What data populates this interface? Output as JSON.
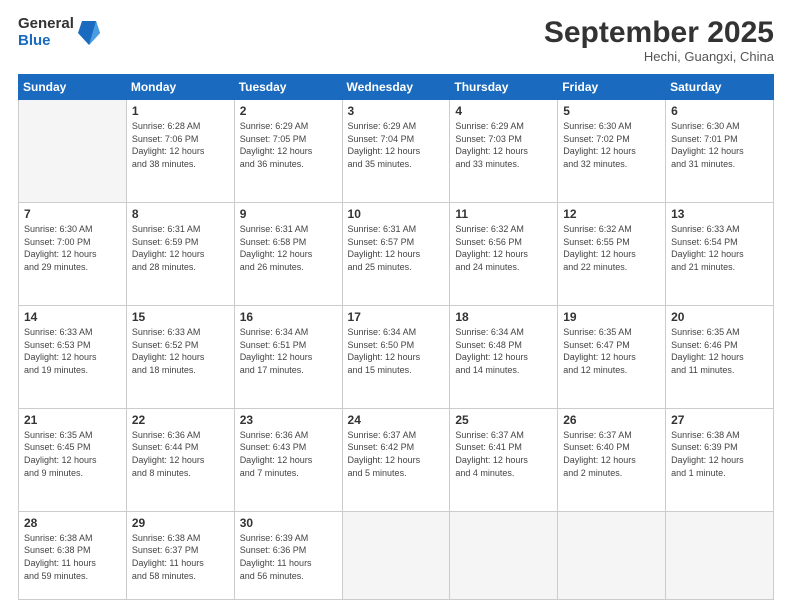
{
  "logo": {
    "general": "General",
    "blue": "Blue"
  },
  "title": {
    "month": "September 2025",
    "location": "Hechi, Guangxi, China"
  },
  "headers": [
    "Sunday",
    "Monday",
    "Tuesday",
    "Wednesday",
    "Thursday",
    "Friday",
    "Saturday"
  ],
  "weeks": [
    [
      {
        "day": "",
        "text": ""
      },
      {
        "day": "1",
        "text": "Sunrise: 6:28 AM\nSunset: 7:06 PM\nDaylight: 12 hours\nand 38 minutes."
      },
      {
        "day": "2",
        "text": "Sunrise: 6:29 AM\nSunset: 7:05 PM\nDaylight: 12 hours\nand 36 minutes."
      },
      {
        "day": "3",
        "text": "Sunrise: 6:29 AM\nSunset: 7:04 PM\nDaylight: 12 hours\nand 35 minutes."
      },
      {
        "day": "4",
        "text": "Sunrise: 6:29 AM\nSunset: 7:03 PM\nDaylight: 12 hours\nand 33 minutes."
      },
      {
        "day": "5",
        "text": "Sunrise: 6:30 AM\nSunset: 7:02 PM\nDaylight: 12 hours\nand 32 minutes."
      },
      {
        "day": "6",
        "text": "Sunrise: 6:30 AM\nSunset: 7:01 PM\nDaylight: 12 hours\nand 31 minutes."
      }
    ],
    [
      {
        "day": "7",
        "text": "Sunrise: 6:30 AM\nSunset: 7:00 PM\nDaylight: 12 hours\nand 29 minutes."
      },
      {
        "day": "8",
        "text": "Sunrise: 6:31 AM\nSunset: 6:59 PM\nDaylight: 12 hours\nand 28 minutes."
      },
      {
        "day": "9",
        "text": "Sunrise: 6:31 AM\nSunset: 6:58 PM\nDaylight: 12 hours\nand 26 minutes."
      },
      {
        "day": "10",
        "text": "Sunrise: 6:31 AM\nSunset: 6:57 PM\nDaylight: 12 hours\nand 25 minutes."
      },
      {
        "day": "11",
        "text": "Sunrise: 6:32 AM\nSunset: 6:56 PM\nDaylight: 12 hours\nand 24 minutes."
      },
      {
        "day": "12",
        "text": "Sunrise: 6:32 AM\nSunset: 6:55 PM\nDaylight: 12 hours\nand 22 minutes."
      },
      {
        "day": "13",
        "text": "Sunrise: 6:33 AM\nSunset: 6:54 PM\nDaylight: 12 hours\nand 21 minutes."
      }
    ],
    [
      {
        "day": "14",
        "text": "Sunrise: 6:33 AM\nSunset: 6:53 PM\nDaylight: 12 hours\nand 19 minutes."
      },
      {
        "day": "15",
        "text": "Sunrise: 6:33 AM\nSunset: 6:52 PM\nDaylight: 12 hours\nand 18 minutes."
      },
      {
        "day": "16",
        "text": "Sunrise: 6:34 AM\nSunset: 6:51 PM\nDaylight: 12 hours\nand 17 minutes."
      },
      {
        "day": "17",
        "text": "Sunrise: 6:34 AM\nSunset: 6:50 PM\nDaylight: 12 hours\nand 15 minutes."
      },
      {
        "day": "18",
        "text": "Sunrise: 6:34 AM\nSunset: 6:48 PM\nDaylight: 12 hours\nand 14 minutes."
      },
      {
        "day": "19",
        "text": "Sunrise: 6:35 AM\nSunset: 6:47 PM\nDaylight: 12 hours\nand 12 minutes."
      },
      {
        "day": "20",
        "text": "Sunrise: 6:35 AM\nSunset: 6:46 PM\nDaylight: 12 hours\nand 11 minutes."
      }
    ],
    [
      {
        "day": "21",
        "text": "Sunrise: 6:35 AM\nSunset: 6:45 PM\nDaylight: 12 hours\nand 9 minutes."
      },
      {
        "day": "22",
        "text": "Sunrise: 6:36 AM\nSunset: 6:44 PM\nDaylight: 12 hours\nand 8 minutes."
      },
      {
        "day": "23",
        "text": "Sunrise: 6:36 AM\nSunset: 6:43 PM\nDaylight: 12 hours\nand 7 minutes."
      },
      {
        "day": "24",
        "text": "Sunrise: 6:37 AM\nSunset: 6:42 PM\nDaylight: 12 hours\nand 5 minutes."
      },
      {
        "day": "25",
        "text": "Sunrise: 6:37 AM\nSunset: 6:41 PM\nDaylight: 12 hours\nand 4 minutes."
      },
      {
        "day": "26",
        "text": "Sunrise: 6:37 AM\nSunset: 6:40 PM\nDaylight: 12 hours\nand 2 minutes."
      },
      {
        "day": "27",
        "text": "Sunrise: 6:38 AM\nSunset: 6:39 PM\nDaylight: 12 hours\nand 1 minute."
      }
    ],
    [
      {
        "day": "28",
        "text": "Sunrise: 6:38 AM\nSunset: 6:38 PM\nDaylight: 11 hours\nand 59 minutes."
      },
      {
        "day": "29",
        "text": "Sunrise: 6:38 AM\nSunset: 6:37 PM\nDaylight: 11 hours\nand 58 minutes."
      },
      {
        "day": "30",
        "text": "Sunrise: 6:39 AM\nSunset: 6:36 PM\nDaylight: 11 hours\nand 56 minutes."
      },
      {
        "day": "",
        "text": ""
      },
      {
        "day": "",
        "text": ""
      },
      {
        "day": "",
        "text": ""
      },
      {
        "day": "",
        "text": ""
      }
    ]
  ]
}
